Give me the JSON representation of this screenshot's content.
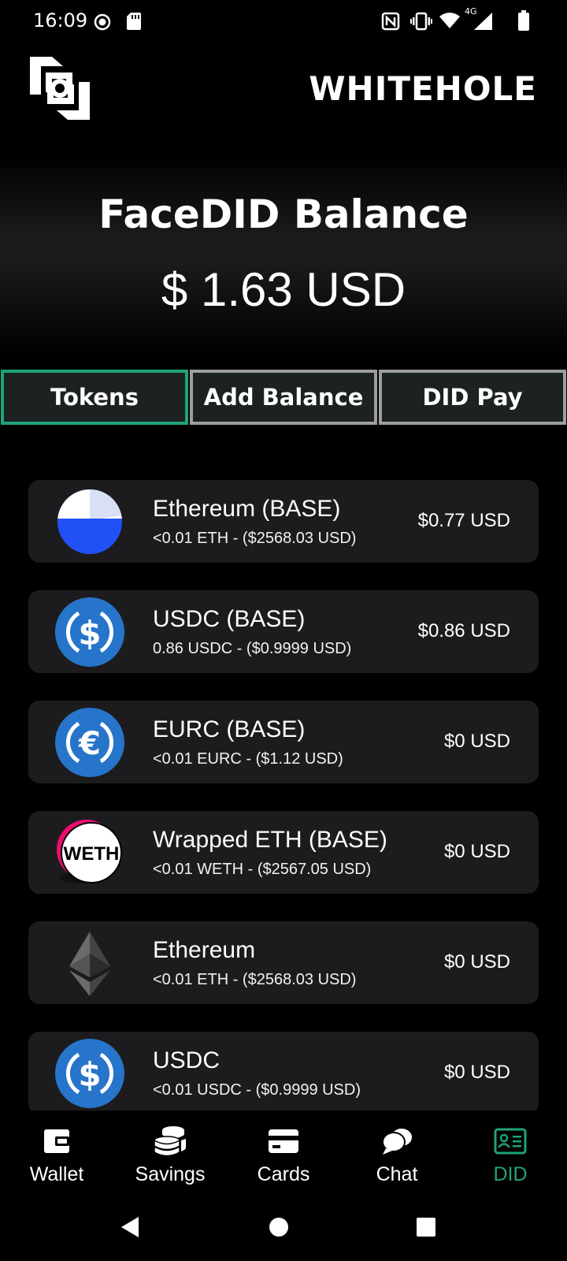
{
  "status_bar": {
    "time": "16:09",
    "network_label": "4G",
    "icons": [
      "record-icon",
      "sd-card-icon",
      "nfc-icon",
      "vibrate-icon",
      "wifi-icon",
      "signal-icon",
      "battery-icon"
    ]
  },
  "header": {
    "brand": "WHITEHOLE",
    "logo_icon": "whitehole-logo"
  },
  "hero": {
    "title": "FaceDID Balance",
    "amount": "$ 1.63 USD"
  },
  "tabs": [
    {
      "label": "Tokens",
      "active": true
    },
    {
      "label": "Add Balance",
      "active": false
    },
    {
      "label": "DID Pay",
      "active": false
    }
  ],
  "tokens": [
    {
      "name": "Ethereum (BASE)",
      "sub": "<0.01 ETH  -  ($2568.03 USD)",
      "value": "$0.77 USD",
      "icon": "base-icon"
    },
    {
      "name": "USDC (BASE)",
      "sub": "0.86 USDC  -  ($0.9999 USD)",
      "value": "$0.86 USD",
      "icon": "usdc-icon"
    },
    {
      "name": "EURC (BASE)",
      "sub": "<0.01 EURC  -  ($1.12 USD)",
      "value": "$0 USD",
      "icon": "eurc-icon"
    },
    {
      "name": "Wrapped ETH (BASE)",
      "sub": "<0.01 WETH  -  ($2567.05 USD)",
      "value": "$0 USD",
      "icon": "weth-icon",
      "icon_text": "WETH"
    },
    {
      "name": "Ethereum",
      "sub": "<0.01 ETH  -  ($2568.03 USD)",
      "value": "$0 USD",
      "icon": "ethereum-icon"
    },
    {
      "name": "USDC",
      "sub": "<0.01 USDC  -  ($0.9999 USD)",
      "value": "$0 USD",
      "icon": "usdc-icon"
    }
  ],
  "bottom_nav": [
    {
      "label": "Wallet",
      "icon": "wallet-icon",
      "active": false
    },
    {
      "label": "Savings",
      "icon": "coins-icon",
      "active": false
    },
    {
      "label": "Cards",
      "icon": "card-icon",
      "active": false
    },
    {
      "label": "Chat",
      "icon": "chat-icon",
      "active": false
    },
    {
      "label": "DID",
      "icon": "id-card-icon",
      "active": true
    }
  ],
  "colors": {
    "accent": "#1fa37a",
    "card_bg": "#1c1c1e",
    "tab_bg": "#1c2121",
    "usdc_blue": "#2775ca",
    "base_blue": "#2151f5"
  }
}
